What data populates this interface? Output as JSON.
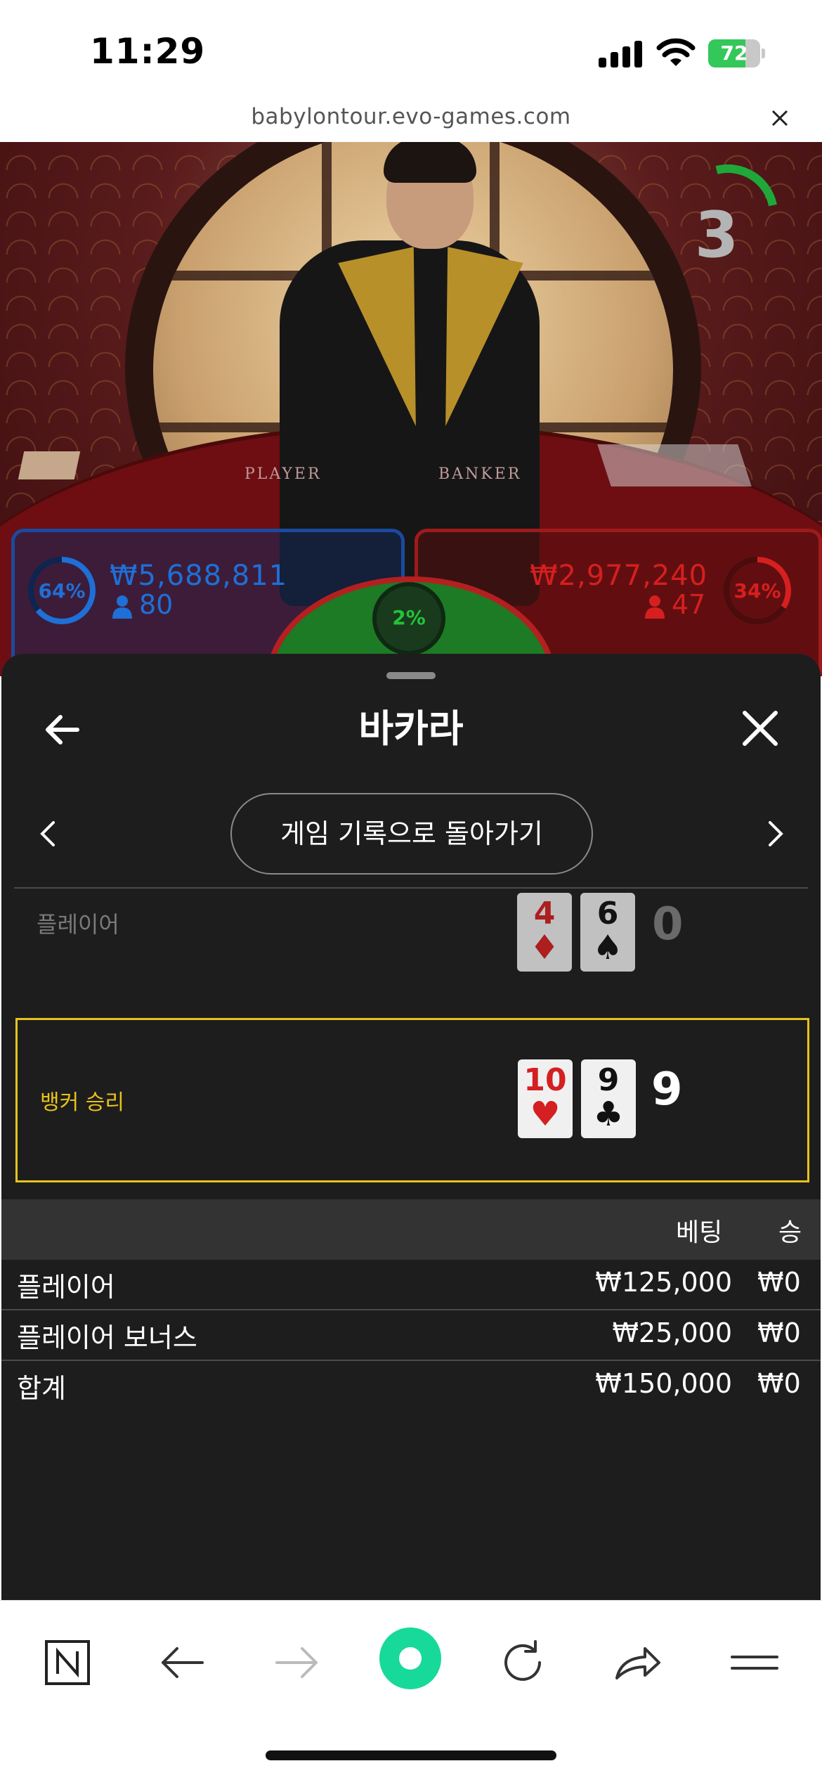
{
  "status_bar": {
    "time": "11:29",
    "battery_level": "72",
    "battery_fraction": 0.72
  },
  "browser": {
    "url": "babylontour.evo-games.com"
  },
  "video": {
    "countdown": "3",
    "table_labels": [
      "PLAYER",
      "BANKER"
    ],
    "player_bet": {
      "percent": "64%",
      "percent_fraction": 0.64,
      "amount": "₩5,688,811",
      "count": "80",
      "color": "#1f6fd6"
    },
    "banker_bet": {
      "percent": "34%",
      "percent_fraction": 0.34,
      "amount": "₩2,977,240",
      "count": "47",
      "color": "#d61f1f"
    },
    "tie_bet": {
      "percent": "2%",
      "color": "#22c33a"
    }
  },
  "sheet": {
    "title": "바카라",
    "back_to_history_label": "게임 기록으로 돌아가기",
    "player_hand": {
      "label": "플레이어",
      "score": "0",
      "cards": [
        {
          "rank": "4",
          "suit": "♦",
          "color": "#d42020"
        },
        {
          "rank": "6",
          "suit": "♠",
          "color": "#111111"
        }
      ]
    },
    "banker_hand": {
      "label": "뱅커 승리",
      "score": "9",
      "cards": [
        {
          "rank": "10",
          "suit": "♥",
          "color": "#d42020"
        },
        {
          "rank": "9",
          "suit": "♣",
          "color": "#111111"
        }
      ]
    },
    "bets_table": {
      "headers": {
        "bet": "베팅",
        "win": "승"
      },
      "rows": [
        {
          "name": "플레이어",
          "bet": "₩125,000",
          "win": "₩0"
        },
        {
          "name": "플레이어 보너스",
          "bet": "₩25,000",
          "win": "₩0"
        },
        {
          "name": "합계",
          "bet": "₩150,000",
          "win": "₩0"
        }
      ]
    },
    "highlight_color": "#e7c21b"
  },
  "toolbar": {
    "items": [
      "naver-icon",
      "back-icon",
      "forward-icon",
      "home-icon",
      "reload-icon",
      "share-icon",
      "menu-icon"
    ],
    "accent": "#17d99a"
  }
}
